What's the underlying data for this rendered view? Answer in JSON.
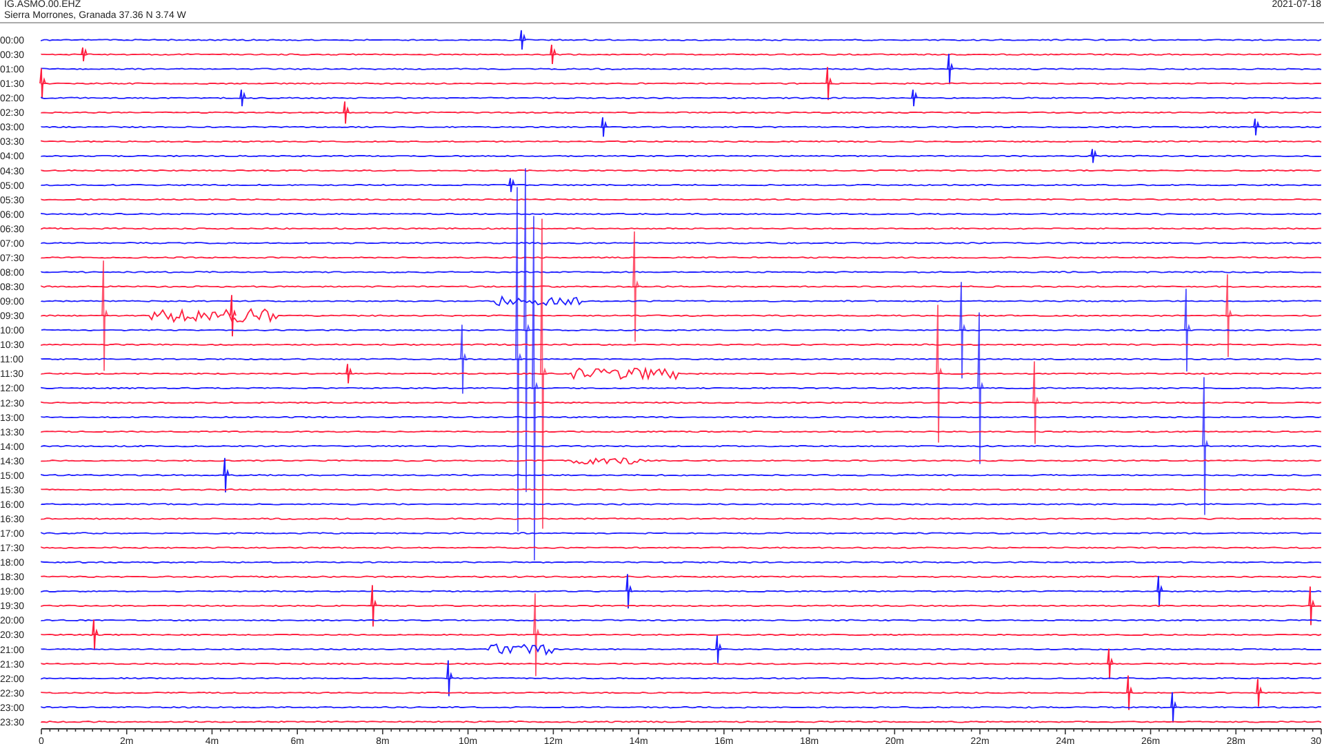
{
  "header": {
    "station": "IG.ASMO.00.EHZ",
    "location": "Sierra Morrones, Granada  37.36 N 3.74 W",
    "date": "2021-07-18"
  },
  "rows": [
    {
      "time": "00:00",
      "color": "#1f1fff"
    },
    {
      "time": "00:30",
      "color": "#ff1f3f"
    },
    {
      "time": "01:00",
      "color": "#1f1fff"
    },
    {
      "time": "01:30",
      "color": "#ff1f3f"
    },
    {
      "time": "02:00",
      "color": "#1f1fff"
    },
    {
      "time": "02:30",
      "color": "#ff1f3f"
    },
    {
      "time": "03:00",
      "color": "#1f1fff"
    },
    {
      "time": "03:30",
      "color": "#ff1f3f"
    },
    {
      "time": "04:00",
      "color": "#1f1fff"
    },
    {
      "time": "04:30",
      "color": "#ff1f3f"
    },
    {
      "time": "05:00",
      "color": "#1f1fff"
    },
    {
      "time": "05:30",
      "color": "#ff1f3f"
    },
    {
      "time": "06:00",
      "color": "#1f1fff"
    },
    {
      "time": "06:30",
      "color": "#ff1f3f"
    },
    {
      "time": "07:00",
      "color": "#1f1fff"
    },
    {
      "time": "07:30",
      "color": "#ff1f3f"
    },
    {
      "time": "08:00",
      "color": "#1f1fff"
    },
    {
      "time": "08:30",
      "color": "#ff1f3f"
    },
    {
      "time": "09:00",
      "color": "#1f1fff"
    },
    {
      "time": "09:30",
      "color": "#ff1f3f"
    },
    {
      "time": "10:00",
      "color": "#1f1fff"
    },
    {
      "time": "10:30",
      "color": "#ff1f3f"
    },
    {
      "time": "11:00",
      "color": "#1f1fff"
    },
    {
      "time": "11:30",
      "color": "#ff1f3f"
    },
    {
      "time": "12:00",
      "color": "#1f1fff"
    },
    {
      "time": "12:30",
      "color": "#ff1f3f"
    },
    {
      "time": "13:00",
      "color": "#1f1fff"
    },
    {
      "time": "13:30",
      "color": "#ff1f3f"
    },
    {
      "time": "14:00",
      "color": "#1f1fff"
    },
    {
      "time": "14:30",
      "color": "#ff1f3f"
    },
    {
      "time": "15:00",
      "color": "#1f1fff"
    },
    {
      "time": "15:30",
      "color": "#ff1f3f"
    },
    {
      "time": "16:00",
      "color": "#1f1fff"
    },
    {
      "time": "16:30",
      "color": "#ff1f3f"
    },
    {
      "time": "17:00",
      "color": "#1f1fff"
    },
    {
      "time": "17:30",
      "color": "#ff1f3f"
    },
    {
      "time": "18:00",
      "color": "#1f1fff"
    },
    {
      "time": "18:30",
      "color": "#ff1f3f"
    },
    {
      "time": "19:00",
      "color": "#1f1fff"
    },
    {
      "time": "19:30",
      "color": "#ff1f3f"
    },
    {
      "time": "20:00",
      "color": "#1f1fff"
    },
    {
      "time": "20:30",
      "color": "#ff1f3f"
    },
    {
      "time": "21:00",
      "color": "#1f1fff"
    },
    {
      "time": "21:30",
      "color": "#ff1f3f"
    },
    {
      "time": "22:00",
      "color": "#1f1fff"
    },
    {
      "time": "22:30",
      "color": "#ff1f3f"
    },
    {
      "time": "23:00",
      "color": "#1f1fff"
    },
    {
      "time": "23:30",
      "color": "#ff1f3f"
    }
  ],
  "x_axis": {
    "ticks": [
      "0",
      "2m",
      "4m",
      "6m",
      "8m",
      "10m",
      "12m",
      "14m",
      "16m",
      "18m",
      "20m",
      "22m",
      "24m",
      "26m",
      "28m",
      "30"
    ]
  }
}
